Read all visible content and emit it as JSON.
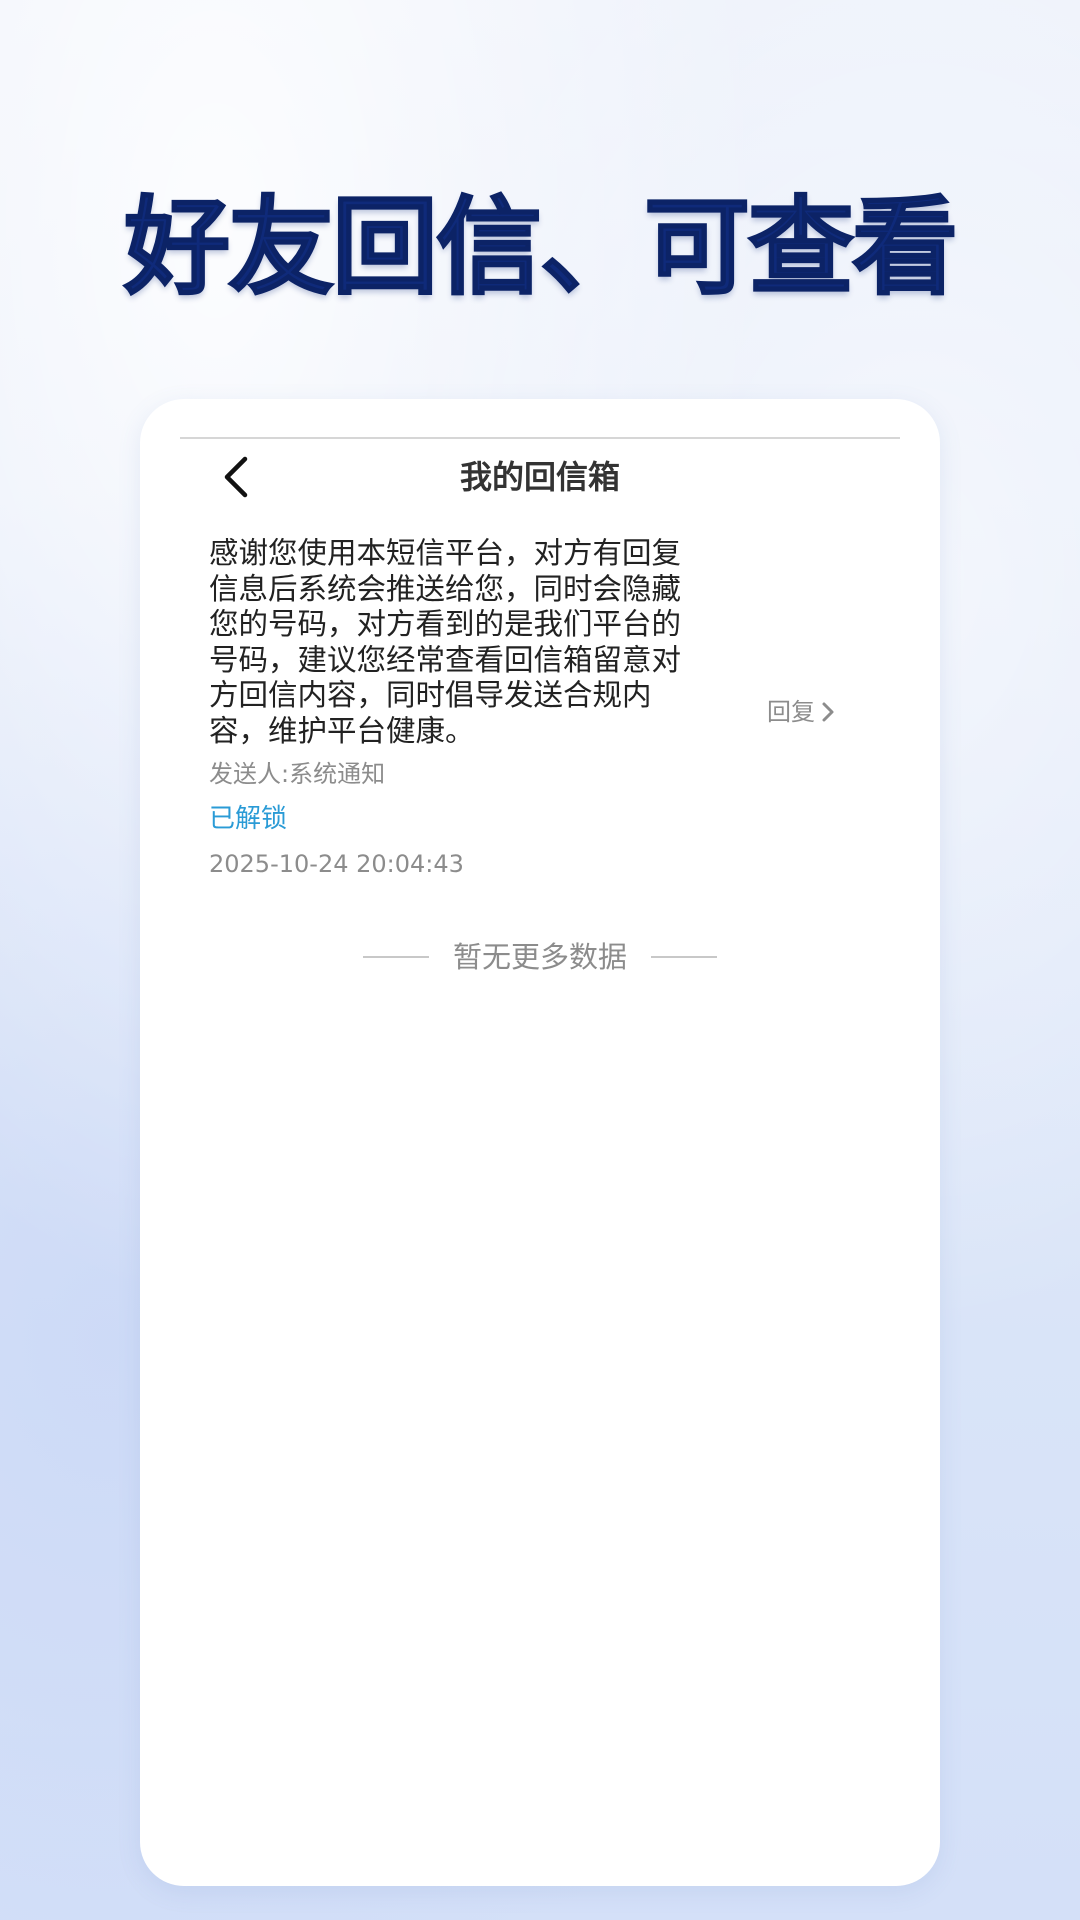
{
  "hero": {
    "title": "好友回信、可查看"
  },
  "colors": {
    "title_navy": "#0f2a7a",
    "unlocked_blue": "#2a9bd6",
    "muted_gray": "#8c8c8c"
  },
  "header": {
    "back_icon": "chevron-left-icon",
    "title": "我的回信箱"
  },
  "messages": [
    {
      "body": "感谢您使用本短信平台，对方有回复信息后系统会推送给您，同时会隐藏您的号码，对方看到的是我们平台的号码，建议您经常查看回信箱留意对方回信内容，同时倡导发送合规内容，维护平台健康。",
      "sender": "发送人:系统通知",
      "status": "已解锁",
      "time": "2025-10-24 20:04:43",
      "reply_label": "回复",
      "reply_icon": "chevron-right-icon"
    }
  ],
  "list_footer": {
    "text": "暂无更多数据"
  }
}
